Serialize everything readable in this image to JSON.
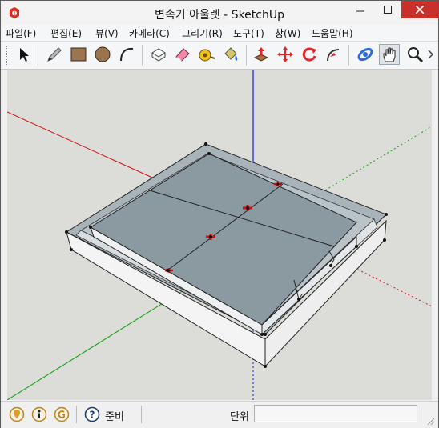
{
  "window": {
    "title": "변속기 아울렛 - SketchUp"
  },
  "menu": {
    "items": [
      "파일(F)",
      "편집(E)",
      "뷰(V)",
      "카메라(C)",
      "그리기(R)",
      "도구(T)",
      "창(W)",
      "도움말(H)"
    ]
  },
  "toolbar": {
    "tools": [
      "select-tool",
      "line-tool",
      "rectangle-tool",
      "circle-tool",
      "arc-tool",
      "make-component-tool",
      "eraser-tool",
      "tape-measure-tool",
      "paint-bucket-tool",
      "push-pull-tool",
      "move-tool",
      "rotate-tool",
      "follow-me-tool",
      "orbit-tool",
      "pan-tool",
      "zoom-tool"
    ],
    "active_tool": "pan-tool"
  },
  "status": {
    "icons": [
      "geo-location-icon",
      "credits-icon",
      "account-icon",
      "help-icon"
    ],
    "text": "준비",
    "measurements_label": "단위",
    "measurements_value": ""
  },
  "colors": {
    "viewport_background": "#dcdcd8",
    "model_face": "#8b99a1",
    "red_axis": "#d01010",
    "green_axis": "#10a010",
    "blue_axis": "#1020e0",
    "close_button": "#c7302b"
  }
}
